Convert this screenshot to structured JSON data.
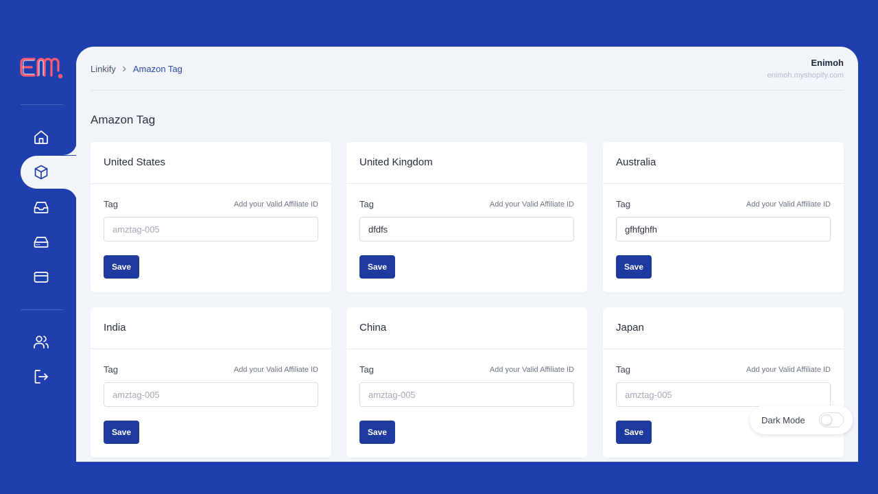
{
  "brand": {
    "logo_text": "em",
    "logo_color": "#ff5a6e"
  },
  "sidebar": {
    "items": [
      {
        "name": "home",
        "icon": "home-icon",
        "active": false
      },
      {
        "name": "products",
        "icon": "box-icon",
        "active": true
      },
      {
        "name": "inbox",
        "icon": "inbox-icon",
        "active": false
      },
      {
        "name": "storage",
        "icon": "drive-icon",
        "active": false
      },
      {
        "name": "billing",
        "icon": "credit-card-icon",
        "active": false
      },
      {
        "name": "users",
        "icon": "users-icon",
        "active": false
      },
      {
        "name": "logout",
        "icon": "logout-icon",
        "active": false
      }
    ]
  },
  "header": {
    "breadcrumb": {
      "root": "Linkify",
      "separator": ">",
      "current": "Amazon Tag"
    },
    "user": {
      "name": "Enimoh",
      "store": "enimoh.myshopify.com"
    }
  },
  "page": {
    "title": "Amazon Tag"
  },
  "cards": [
    {
      "country": "United States",
      "label": "Tag",
      "hint": "Add your Valid Affiliate ID",
      "value": "",
      "placeholder": "amztag-005",
      "save_label": "Save"
    },
    {
      "country": "United Kingdom",
      "label": "Tag",
      "hint": "Add your Valid Affiliate ID",
      "value": "dfdfs",
      "placeholder": "amztag-005",
      "save_label": "Save"
    },
    {
      "country": "Australia",
      "label": "Tag",
      "hint": "Add your Valid Affiliate ID",
      "value": "gfhfghfh",
      "placeholder": "amztag-005",
      "save_label": "Save"
    },
    {
      "country": "India",
      "label": "Tag",
      "hint": "Add your Valid Affiliate ID",
      "value": "",
      "placeholder": "amztag-005",
      "save_label": "Save"
    },
    {
      "country": "China",
      "label": "Tag",
      "hint": "Add your Valid Affiliate ID",
      "value": "",
      "placeholder": "amztag-005",
      "save_label": "Save"
    },
    {
      "country": "Japan",
      "label": "Tag",
      "hint": "Add your Valid Affiliate ID",
      "value": "",
      "placeholder": "amztag-005",
      "save_label": "Save"
    }
  ],
  "dark_mode": {
    "label": "Dark Mode",
    "enabled": false
  },
  "colors": {
    "background": "#1e3fad",
    "panel": "#f1f5f9",
    "primary_button": "#1f3a9e",
    "breadcrumb_active": "#2a4aa8"
  }
}
